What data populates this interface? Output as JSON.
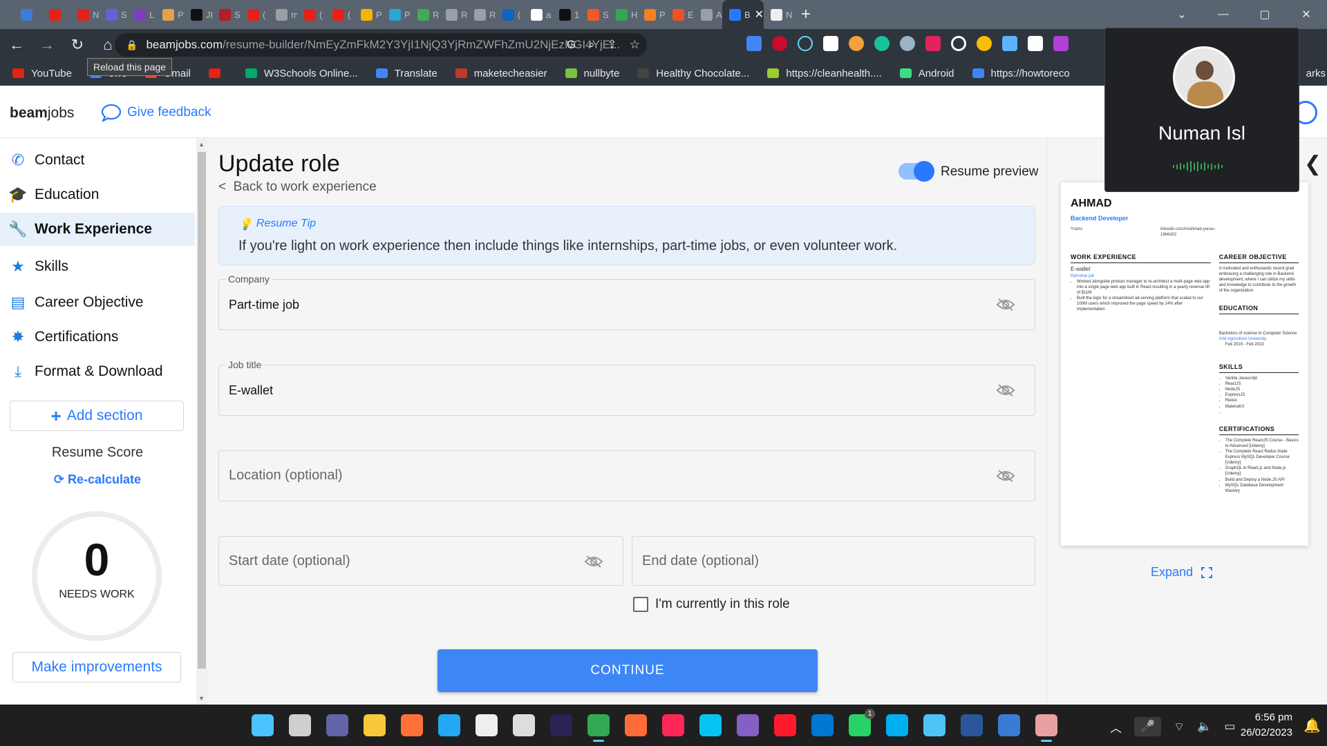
{
  "browser": {
    "tabs": [
      {
        "icon": "gem-icon",
        "color": "#3d7bd8",
        "label": ""
      },
      {
        "icon": "youtube-icon",
        "color": "#e62117",
        "label": ""
      },
      {
        "icon": "youtube-icon",
        "color": "#e62117",
        "label": "N"
      },
      {
        "icon": "stripe-icon",
        "color": "#6860d8",
        "label": "S"
      },
      {
        "icon": "code-icon",
        "color": "#7b3fbf",
        "label": "L"
      },
      {
        "icon": "figure-icon",
        "color": "#e3a248",
        "label": "P"
      },
      {
        "icon": "k-icon",
        "color": "#111111",
        "label": "JI"
      },
      {
        "icon": "sa-icon",
        "color": "#b21f2a",
        "label": "S"
      },
      {
        "icon": "youtube-icon",
        "color": "#e62117",
        "label": "("
      },
      {
        "icon": "refresh-icon",
        "color": "#9aa0a6",
        "label": "m"
      },
      {
        "icon": "youtube-icon",
        "color": "#e62117",
        "label": "("
      },
      {
        "icon": "youtube-icon",
        "color": "#e62117",
        "label": "("
      },
      {
        "icon": "drive-icon",
        "color": "#f4b400",
        "label": "P"
      },
      {
        "icon": "n-icon",
        "color": "#2aa8d5",
        "label": "P"
      },
      {
        "icon": "leaf-icon",
        "color": "#44aa55",
        "label": "R"
      },
      {
        "icon": "globe-icon",
        "color": "#9aa0a6",
        "label": "R"
      },
      {
        "icon": "globe-icon",
        "color": "#9aa0a6",
        "label": "R"
      },
      {
        "icon": "linkedin-icon",
        "color": "#0a66c2",
        "label": "("
      },
      {
        "icon": "google-icon",
        "color": "#ffffff",
        "label": "a"
      },
      {
        "icon": "medium-icon",
        "color": "#111111",
        "label": "1"
      },
      {
        "icon": "box-icon",
        "color": "#f05a28",
        "label": "S"
      },
      {
        "icon": "infinity-icon",
        "color": "#33a852",
        "label": "H"
      },
      {
        "icon": "stack-icon",
        "color": "#f48024",
        "label": "P"
      },
      {
        "icon": "windows-icon",
        "color": "#f25022",
        "label": "E"
      },
      {
        "icon": "globe-icon",
        "color": "#9aa0a6",
        "label": "A"
      },
      {
        "icon": "beam-icon",
        "color": "#2979ff",
        "label": "Be",
        "active": true
      },
      {
        "icon": "github-icon",
        "color": "#eeeeee",
        "label": "N"
      }
    ],
    "url_host": "beamjobs.com",
    "url_path": "/resume-builder/NmEyZmFkM2Y3YjI1NjQ3YjRmZWFhZmU2NjEzNGI4YjE...",
    "tooltip": "Reload this page",
    "bookmarks": [
      {
        "label": "YouTube",
        "icon": "youtube-icon",
        "color": "#e62117"
      },
      {
        "label": "ews",
        "icon": "news-icon",
        "color": "#4285f4"
      },
      {
        "label": "Gmail",
        "icon": "gmail-icon",
        "color": "#ea4335"
      },
      {
        "label": "",
        "icon": "youtube-icon",
        "color": "#e62117"
      },
      {
        "label": "W3Schools Online...",
        "icon": "w3-icon",
        "color": "#04aa6d"
      },
      {
        "label": "Translate",
        "icon": "translate-icon",
        "color": "#4285f4"
      },
      {
        "label": "maketecheasier",
        "icon": "m-icon",
        "color": "#c0392b"
      },
      {
        "label": "nullbyte",
        "icon": "nullbyte-icon",
        "color": "#7ac143"
      },
      {
        "label": "Healthy Chocolate...",
        "icon": "w-icon",
        "color": "#444444"
      },
      {
        "label": "https://cleanhealth....",
        "icon": "dot-icon",
        "color": "#9acd32"
      },
      {
        "label": "Android",
        "icon": "android-icon",
        "color": "#3ddc84"
      },
      {
        "label": "https://howtoreco",
        "icon": "slash-icon",
        "color": "#3d86f5"
      }
    ],
    "bookmarks_tail": "arks"
  },
  "app": {
    "logo_bold": "beam",
    "logo_rest": "jobs",
    "feedback_label": "Give feedback"
  },
  "sidebar": {
    "items": [
      {
        "label": "Contact",
        "icon": "phone-icon",
        "glyph": "✆"
      },
      {
        "label": "Education",
        "icon": "graduation-cap-icon",
        "glyph": "🎓"
      },
      {
        "label": "Work Experience",
        "icon": "wrench-icon",
        "glyph": "🔧",
        "active": true
      },
      {
        "label": "Skills",
        "icon": "star-icon",
        "glyph": "★"
      },
      {
        "label": "Career Objective",
        "icon": "book-icon",
        "glyph": "▤"
      },
      {
        "label": "Certifications",
        "icon": "badge-icon",
        "glyph": "✸"
      },
      {
        "label": "Format & Download",
        "icon": "download-icon",
        "glyph": "⤓"
      }
    ],
    "add_section": "Add section",
    "score_label": "Resume Score",
    "recalc_label": "Re-calculate",
    "score": "0",
    "score_status": "NEEDS WORK",
    "improve_label": "Make improvements"
  },
  "main": {
    "title": "Update role",
    "back_label": "Back to work experience",
    "preview_toggle_label": "Resume preview",
    "preview_on": true,
    "tip_heading": "Resume Tip",
    "tip_text": "If you're light on work experience then include things like internships, part-time jobs, or even volunteer work.",
    "fields": {
      "company": {
        "label": "Company",
        "value": "Part-time job"
      },
      "job_title": {
        "label": "Job title",
        "value": "E-wallet"
      },
      "location": {
        "placeholder": "Location (optional)"
      },
      "start_date": {
        "placeholder": "Start date (optional)"
      },
      "end_date": {
        "placeholder": "End date (optional)"
      }
    },
    "current_role_label": "I'm currently in this role",
    "current_role_checked": false,
    "continue_label": "CONTINUE"
  },
  "preview": {
    "name": "AHMAD",
    "role": "Backend Developer",
    "contact_left": "Yrams",
    "contact_right": "linkedin.com/in/ahmad-yunas-18b6d02",
    "work_heading": "WORK EXPERIENCE",
    "job": "E-wallet",
    "company": "Part-time job",
    "bullets": [
      "Worked alongside product manager to re-architect a multi-page web app into a single page web app built in React resulting in a yearly revenue lift of $11M",
      "Built the logic for a streamlined ad-serving platform that scaled to our 100M users which improved the page speed by 14% after implementation"
    ],
    "career_heading": "CAREER OBJECTIVE",
    "career_text": "A motivated and enthusiastic recent grad embracing a challenging role in Backend development, where I can utilize my skills and knowledge to contribute to the growth of the organization.",
    "edu_heading": "EDUCATION",
    "degree": "Bachelors of science in Computer Science",
    "school": "Arid Agriculture University",
    "edu_dates": "Feb 2019 - Feb 2023",
    "skills_heading": "SKILLS",
    "skills": [
      "Vanilla Javascript",
      "ReactJS",
      "NodeJS",
      "ExpressJS",
      "Redux",
      "MaterialUI",
      ""
    ],
    "cert_heading": "CERTIFICATIONS",
    "certs": [
      "The Complete ReactJS Course - Basics to Advanced [Udemy]",
      "The Complete React Redux Node Express MySQL Developer Course [Udemy]",
      "GraphQL in React.js and Node.js [Udemy]",
      "Build and Deploy a Node.JS API",
      "MySQL Database Development Mastery"
    ],
    "expand_label": "Expand"
  },
  "profile_popup": {
    "name": "Numan Isl"
  },
  "taskbar": {
    "apps": [
      {
        "icon": "windows-start-icon",
        "color": "#4cc2ff"
      },
      {
        "icon": "task-view-icon",
        "color": "#cfcfcf"
      },
      {
        "icon": "teams-chat-icon",
        "color": "#6264a7"
      },
      {
        "icon": "file-explorer-icon",
        "color": "#f8c93a"
      },
      {
        "icon": "firefox-icon",
        "color": "#ff7139"
      },
      {
        "icon": "vscode-icon",
        "color": "#23a9f2"
      },
      {
        "icon": "wordpad-icon",
        "color": "#eeeeee"
      },
      {
        "icon": "calendar-icon",
        "color": "#dddddd"
      },
      {
        "icon": "eclipse-icon",
        "color": "#2c2255"
      },
      {
        "icon": "chrome-icon",
        "color": "#34a853",
        "active": true
      },
      {
        "icon": "postman-icon",
        "color": "#ff6c37"
      },
      {
        "icon": "intellij-icon",
        "color": "#fe2857"
      },
      {
        "icon": "webstorm-icon",
        "color": "#07c3f2"
      },
      {
        "icon": "visual-studio-icon",
        "color": "#865fc5"
      },
      {
        "icon": "opera-icon",
        "color": "#ff1b2d"
      },
      {
        "icon": "mail-icon",
        "color": "#0078d4"
      },
      {
        "icon": "whatsapp-icon",
        "color": "#25d366"
      },
      {
        "icon": "skype-icon",
        "color": "#00aff0"
      },
      {
        "icon": "notepad-icon",
        "color": "#4fc3f7"
      },
      {
        "icon": "word-icon",
        "color": "#2b579a"
      },
      {
        "icon": "network-icon",
        "color": "#3a7bd5"
      },
      {
        "icon": "snipping-tool-icon",
        "color": "#e8a0a0",
        "active": true
      }
    ],
    "whatsapp_badge": "1",
    "time": "6:56 pm",
    "date": "26/02/2023"
  }
}
